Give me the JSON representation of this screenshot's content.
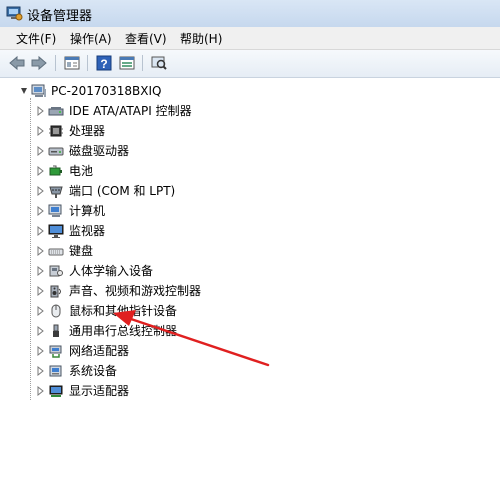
{
  "window": {
    "title": "设备管理器"
  },
  "menu": [
    "文件(F)",
    "操作(A)",
    "查看(V)",
    "帮助(H)"
  ],
  "toolbar": {
    "buttons": [
      "back-icon",
      "forward-icon",
      "properties-icon",
      "help-icon",
      "view-icon",
      "scan-icon"
    ]
  },
  "tree": {
    "root": "PC-20170318BXIQ",
    "items": [
      {
        "label": "IDE ATA/ATAPI 控制器",
        "icon": "ide-controller-icon"
      },
      {
        "label": "处理器",
        "icon": "processor-icon"
      },
      {
        "label": "磁盘驱动器",
        "icon": "disk-drive-icon"
      },
      {
        "label": "电池",
        "icon": "battery-icon"
      },
      {
        "label": "端口 (COM 和 LPT)",
        "icon": "port-icon"
      },
      {
        "label": "计算机",
        "icon": "computer-icon"
      },
      {
        "label": "监视器",
        "icon": "monitor-icon"
      },
      {
        "label": "键盘",
        "icon": "keyboard-icon"
      },
      {
        "label": "人体学输入设备",
        "icon": "hid-icon"
      },
      {
        "label": "声音、视频和游戏控制器",
        "icon": "sound-icon"
      },
      {
        "label": "鼠标和其他指针设备",
        "icon": "mouse-icon"
      },
      {
        "label": "通用串行总线控制器",
        "icon": "usb-icon"
      },
      {
        "label": "网络适配器",
        "icon": "network-icon"
      },
      {
        "label": "系统设备",
        "icon": "system-icon"
      },
      {
        "label": "显示适配器",
        "icon": "display-adapter-icon"
      }
    ]
  },
  "colors": {
    "annotation_arrow": "#e02020",
    "titlebar": "#d3e2f4"
  }
}
